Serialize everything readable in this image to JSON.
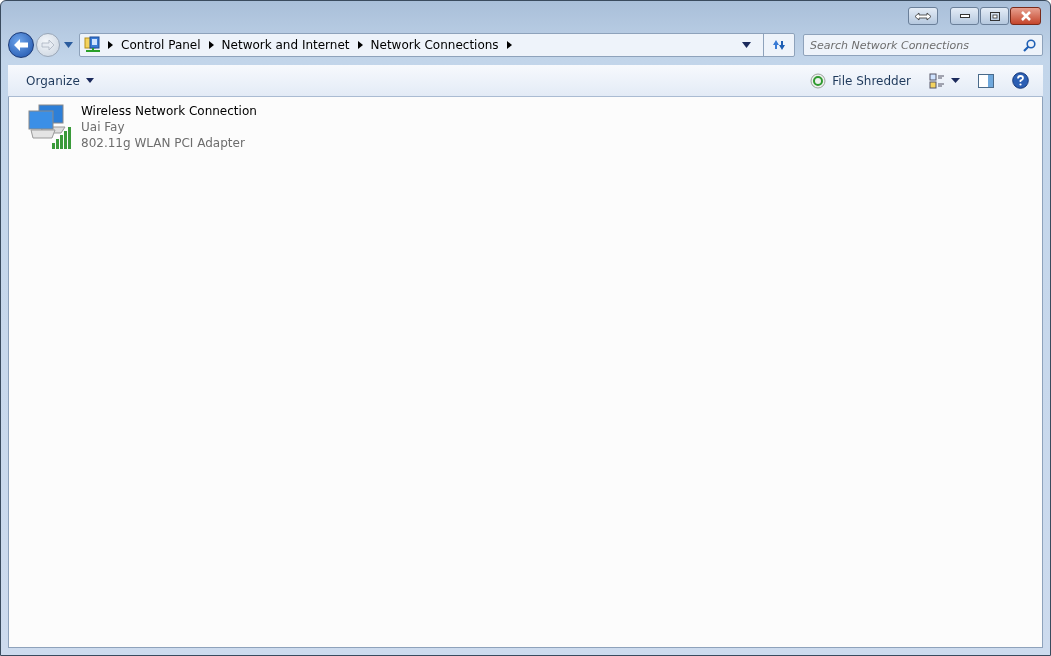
{
  "address_bar": {
    "breadcrumbs": [
      "Control Panel",
      "Network and Internet",
      "Network Connections"
    ]
  },
  "search": {
    "placeholder": "Search Network Connections"
  },
  "toolbar": {
    "organize": "Organize",
    "shredder": "File Shredder"
  },
  "connections": [
    {
      "name": "Wireless Network Connection",
      "network": "Uai Fay",
      "adapter": "802.11g WLAN PCI Adapter"
    }
  ]
}
